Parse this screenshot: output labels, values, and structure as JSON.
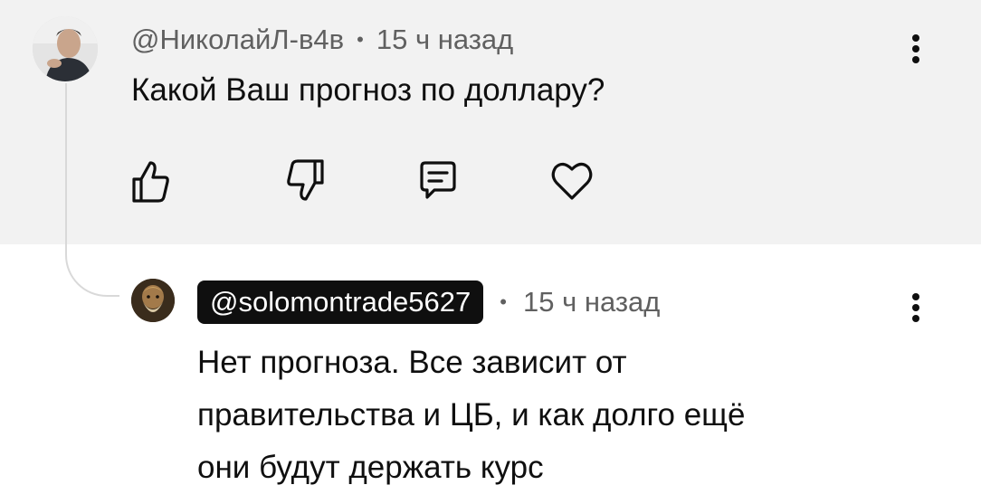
{
  "thread": {
    "parent": {
      "author": "@НиколайЛ-в4в",
      "separator": "•",
      "time": "15 ч назад",
      "text": "Какой Ваш прогноз по доллару?",
      "actions": [
        "like-icon",
        "dislike-icon",
        "reply-icon",
        "heart-icon"
      ],
      "menu_icon": "kebab-menu-icon"
    },
    "reply": {
      "author": "@solomontrade5627",
      "separator": "•",
      "time": "15 ч назад",
      "text_lines": [
        "Нет прогноза. Все зависит от",
        "правительства и ЦБ, и как долго ещё",
        "они будут держать курс"
      ],
      "menu_icon": "kebab-menu-icon"
    }
  },
  "colors": {
    "highlight_bg": "#f2f2f2",
    "meta_text": "#606060",
    "body_text": "#0f0f0f",
    "author_pill_bg": "#0f0f0f",
    "thread_line": "#d9d9d9"
  }
}
